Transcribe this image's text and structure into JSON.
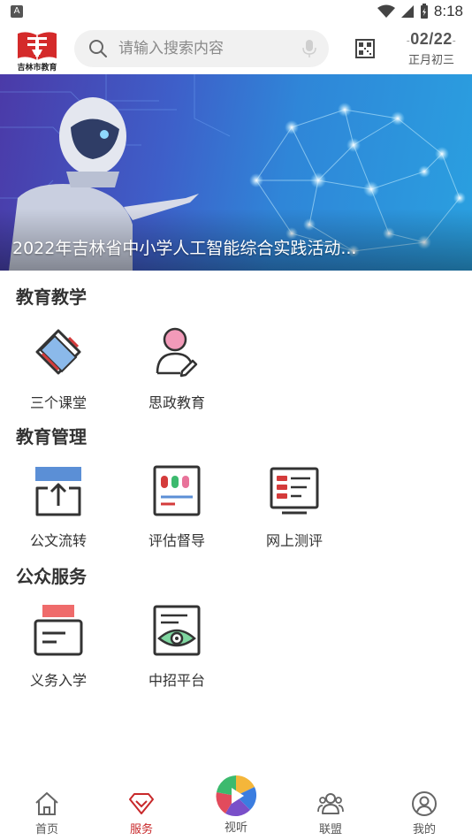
{
  "status_bar": {
    "time": "8:18",
    "notification_badge": "A"
  },
  "header": {
    "logo_text": "吉林市教育",
    "search_placeholder": "请输入搜索内容",
    "date": "02/22",
    "lunar_date": "正月初三"
  },
  "banner": {
    "caption": "2022年吉林省中小学人工智能综合实践活动..."
  },
  "sections": [
    {
      "title": "教育教学",
      "items": [
        {
          "label": "三个课堂",
          "icon": "classroom-diamond-icon"
        },
        {
          "label": "思政教育",
          "icon": "person-pen-icon"
        }
      ]
    },
    {
      "title": "教育管理",
      "items": [
        {
          "label": "公文流转",
          "icon": "document-upload-icon"
        },
        {
          "label": "评估督导",
          "icon": "evaluation-board-icon"
        },
        {
          "label": "网上测评",
          "icon": "online-test-icon"
        }
      ]
    },
    {
      "title": "公众服务",
      "items": [
        {
          "label": "义务入学",
          "icon": "enrollment-card-icon"
        },
        {
          "label": "中招平台",
          "icon": "eye-document-icon"
        }
      ]
    }
  ],
  "bottom_nav": [
    {
      "label": "首页",
      "icon": "home-icon",
      "active": false
    },
    {
      "label": "服务",
      "icon": "diamond-service-icon",
      "active": true
    },
    {
      "label": "视听",
      "icon": "camera-aperture-icon",
      "active": false
    },
    {
      "label": "联盟",
      "icon": "group-users-icon",
      "active": false
    },
    {
      "label": "我的",
      "icon": "user-profile-icon",
      "active": false
    }
  ],
  "colors": {
    "accent_red": "#c8282a",
    "icon_blue": "#5b8fd6",
    "icon_dark": "#333333",
    "icon_pink": "#e8739a",
    "icon_green": "#3cba6e"
  }
}
